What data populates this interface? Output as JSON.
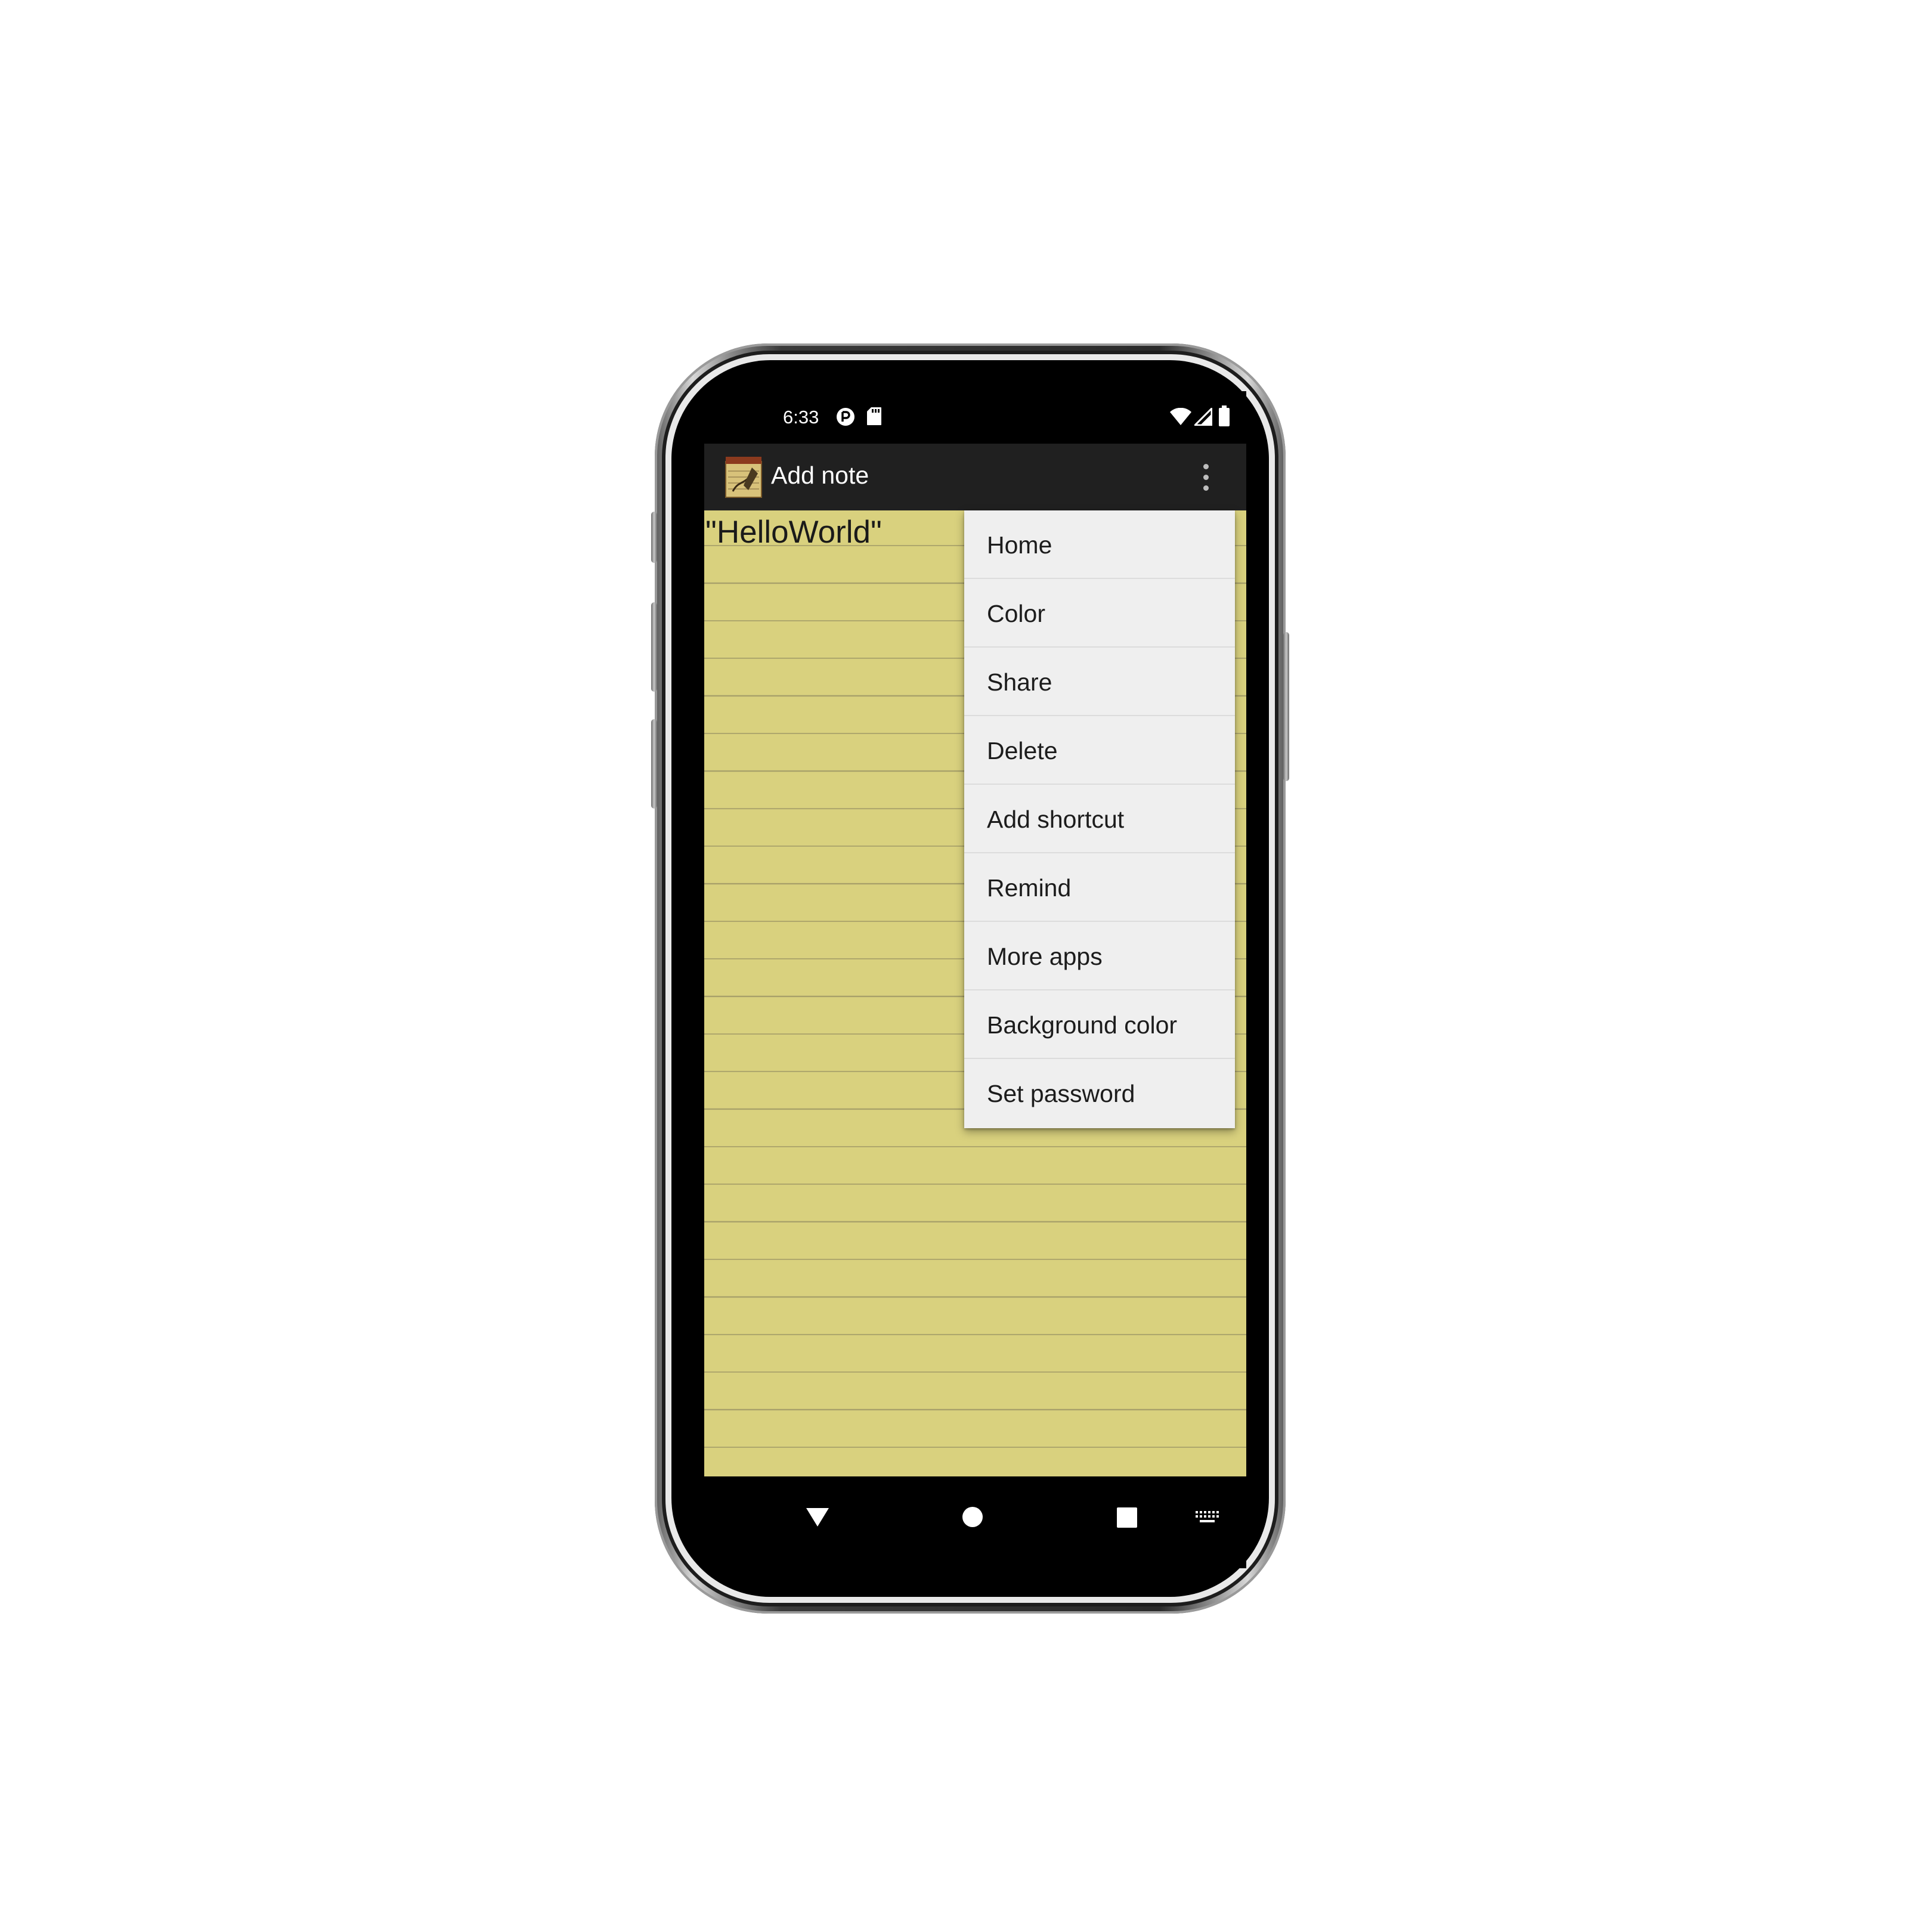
{
  "status_bar": {
    "time": "6:33",
    "icons": [
      "notification-circle-icon",
      "sd-card-icon",
      "wifi-icon",
      "cell-signal-icon",
      "battery-icon"
    ]
  },
  "app_bar": {
    "title": "Add note",
    "logo_icon": "notepad-icon",
    "overflow_icon": "more-vert-icon"
  },
  "note": {
    "text": "\"HelloWorld\"",
    "paper_color": "#d9d17e",
    "line_color": "#a8a16a"
  },
  "menu": {
    "items": [
      {
        "label": "Home"
      },
      {
        "label": "Color"
      },
      {
        "label": "Share"
      },
      {
        "label": "Delete"
      },
      {
        "label": "Add shortcut"
      },
      {
        "label": "Remind"
      },
      {
        "label": "More apps"
      },
      {
        "label": "Background color"
      },
      {
        "label": "Set password"
      }
    ]
  },
  "nav_bar": {
    "icons": [
      "back-icon",
      "home-icon",
      "recents-icon",
      "keyboard-icon"
    ]
  }
}
